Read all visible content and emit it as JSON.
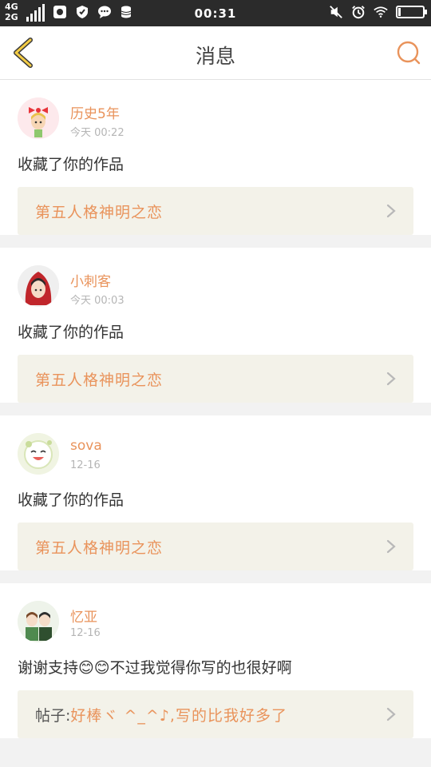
{
  "status_bar": {
    "network_top": "4G",
    "network_bottom": "2G",
    "time": "00:31"
  },
  "header": {
    "title": "消息",
    "accent_color": "#e9935b"
  },
  "messages": [
    {
      "user": "历史5年",
      "time": "今天 00:22",
      "action": "收藏了你的作品",
      "ref_title": "第五人格神明之恋"
    },
    {
      "user": "小刺客",
      "time": "今天 00:03",
      "action": "收藏了你的作品",
      "ref_title": "第五人格神明之恋"
    },
    {
      "user": "sova",
      "time": "12-16",
      "action": "收藏了你的作品",
      "ref_title": "第五人格神明之恋"
    },
    {
      "user": "忆亚",
      "time": "12-16",
      "action": "谢谢支持😊😊不过我觉得你写的也很好啊",
      "ref_prefix": "帖子:",
      "ref_title": "好棒ヾ ^_^♪,写的比我好多了"
    }
  ]
}
